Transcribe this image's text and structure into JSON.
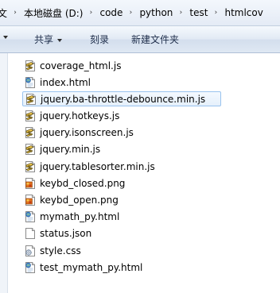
{
  "address": {
    "crumbs": [
      "文",
      "本地磁盘 (D:)",
      "code",
      "python",
      "test",
      "htmlcov"
    ],
    "separator": "›"
  },
  "toolbar": {
    "share_label": "共享",
    "burn_label": "刻录",
    "new_folder_label": "新建文件夹"
  },
  "files": [
    {
      "name": "coverage_html.js",
      "icon": "js-script-icon"
    },
    {
      "name": "index.html",
      "icon": "html-file-icon"
    },
    {
      "name": "jquery.ba-throttle-debounce.min.js",
      "icon": "js-script-icon",
      "selected": true
    },
    {
      "name": "jquery.hotkeys.js",
      "icon": "js-script-icon"
    },
    {
      "name": "jquery.isonscreen.js",
      "icon": "js-script-icon"
    },
    {
      "name": "jquery.min.js",
      "icon": "js-script-icon"
    },
    {
      "name": "jquery.tablesorter.min.js",
      "icon": "js-script-icon"
    },
    {
      "name": "keybd_closed.png",
      "icon": "png-image-icon"
    },
    {
      "name": "keybd_open.png",
      "icon": "png-image-icon"
    },
    {
      "name": "mymath_py.html",
      "icon": "html-file-icon"
    },
    {
      "name": "status.json",
      "icon": "blank-file-icon"
    },
    {
      "name": "style.css",
      "icon": "css-file-icon"
    },
    {
      "name": "test_mymath_py.html",
      "icon": "html-file-icon"
    }
  ]
}
